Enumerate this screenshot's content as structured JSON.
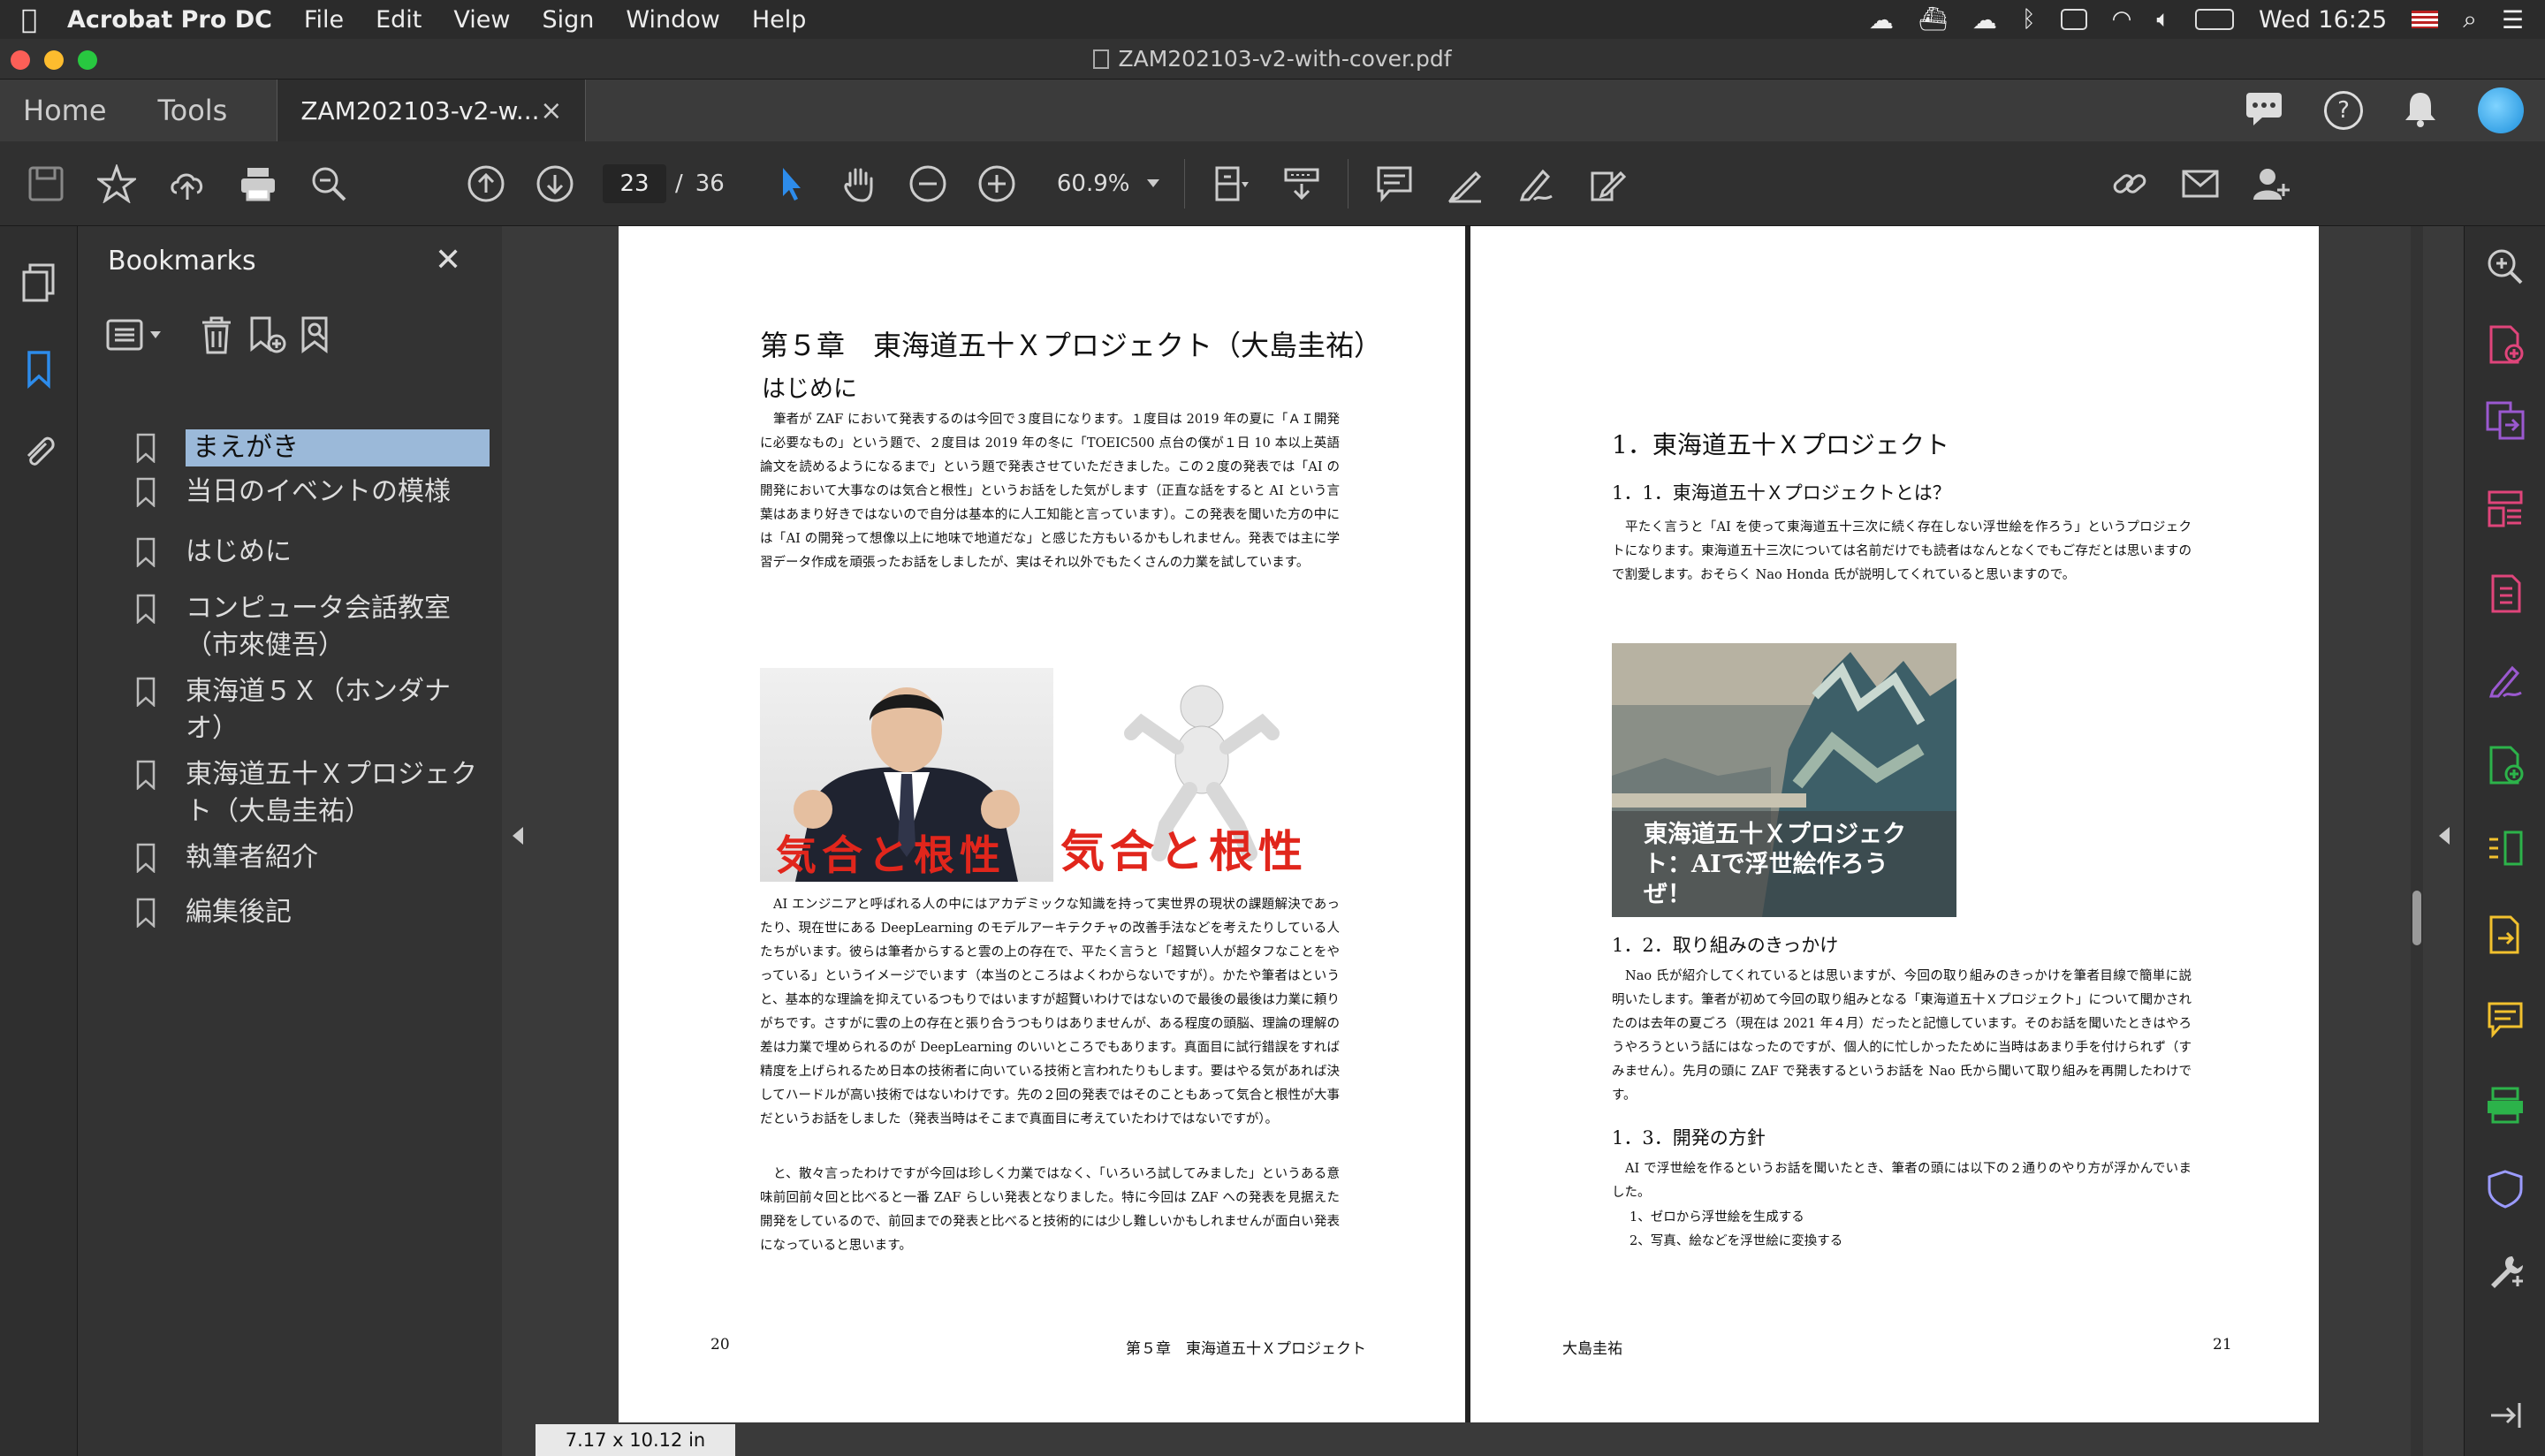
{
  "menubar": {
    "app_name": "Acrobat Pro DC",
    "items": [
      "File",
      "Edit",
      "View",
      "Sign",
      "Window",
      "Help"
    ],
    "clock": "Wed 16:25"
  },
  "window": {
    "title": "ZAM202103-v2-with-cover.pdf"
  },
  "tabs": {
    "home": "Home",
    "tools": "Tools",
    "document": "ZAM202103-v2-w...",
    "close": "×"
  },
  "toolbar": {
    "current_page": "23",
    "page_separator": "/",
    "total_pages": "36",
    "zoom": "60.9%"
  },
  "bookmarks": {
    "title": "Bookmarks",
    "close": "✕",
    "items": [
      {
        "label": "まえがき",
        "selected": true
      },
      {
        "label": "当日のイベントの模様"
      },
      {
        "label": "はじめに"
      },
      {
        "label": "コンピュータ会話教室（市來健吾）"
      },
      {
        "label": "東海道５Ｘ（ホンダナオ）"
      },
      {
        "label": "東海道五十Ｘプロジェクト（大島圭祐）"
      },
      {
        "label": "執筆者紹介"
      },
      {
        "label": "編集後記"
      }
    ]
  },
  "page_left": {
    "chapter_title": "第５章　東海道五十Ｘプロジェクト（大島圭祐）",
    "section": "はじめに",
    "para1": "筆者が ZAF において発表するのは今回で３度目になります。１度目は 2019 年の夏に「ＡＩ開発に必要なもの」という題で、２度目は 2019 年の冬に「TOEIC500 点台の僕が１日 10 本以上英語論文を読めるようになるまで」という題で発表させていただきました。この２度の発表では「AI の開発において大事なのは気合と根性」というお話をした気がします（正直な話をすると AI という言葉はあまり好きではないので自分は基本的に人工知能と言っています）。この発表を聞いた方の中には「AI の開発って想像以上に地味で地道だな」と感じた方もいるかもしれません。発表では主に学習データ作成を頑張ったお話をしましたが、実はそれ以外でもたくさんの力業を試しています。",
    "kiai1": "気合と根性",
    "kiai2": "気合と根性",
    "para2": "AI エンジニアと呼ばれる人の中にはアカデミックな知識を持って実世界の現状の課題解決であったり、現在世にある DeepLearning のモデルアーキテクチャの改善手法などを考えたりしている人たちがいます。彼らは筆者からすると雲の上の存在で、平たく言うと「超賢い人が超タフなことをやっている」というイメージでいます（本当のところはよくわからないですが）。かたや筆者はというと、基本的な理論を抑えているつもりではいますが超賢いわけではないので最後の最後は力業に頼りがちです。さすがに雲の上の存在と張り合うつもりはありませんが、ある程度の頭脳、理論の理解の差は力業で埋められるのが DeepLearning のいいところでもあります。真面目に試行錯誤をすれば精度を上げられるため日本の技術者に向いている技術と言われたりもします。要はやる気があれば決してハードルが高い技術ではないわけです。先の２回の発表ではそのこともあって気合と根性が大事だというお話をしました（発表当時はそこまで真面目に考えていたわけではないですが）。",
    "para3": "と、散々言ったわけですが今回は珍しく力業ではなく、「いろいろ試してみました」というある意味前回前々回と比べると一番 ZAF らしい発表となりました。特に今回は ZAF への発表を見据えた開発をしているので、前回までの発表と比べると技術的には少し難しいかもしれませんが面白い発表になっていると思います。",
    "page_number": "20",
    "running_head": "第５章　東海道五十Ｘプロジェクト"
  },
  "page_right": {
    "heading": "1．東海道五十Ｘプロジェクト",
    "sub1": "1．1．東海道五十Ｘプロジェクトとは？",
    "para1": "平たく言うと「AI を使って東海道五十三次に続く存在しない浮世絵を作ろう」というプロジェクトになります。東海道五十三次については名前だけでも読者はなんとなくでもご存だとは思いますので割愛します。おそらく Nao Honda 氏が説明してくれていると思いますので。",
    "image_caption": "東海道五十Ｘプロジェクト：AIで浮世絵作ろうぜ！",
    "sub2": "1．2．取り組みのきっかけ",
    "para2": "Nao 氏が紹介してくれているとは思いますが、今回の取り組みのきっかけを筆者目線で簡単に説明いたします。筆者が初めて今回の取り組みとなる「東海道五十Ｘプロジェクト」について聞かされたのは去年の夏ごろ（現在は 2021 年４月）だったと記憶しています。そのお話を聞いたときはやろうやろうという話にはなったのですが、個人的に忙しかったために当時はあまり手を付けられず（すみません）。先月の頭に ZAF で発表するというお話を Nao 氏から聞いて取り組みを再開したわけです。",
    "sub3": "1．3．開発の方針",
    "para3": "AI で浮世絵を作るというお話を聞いたとき、筆者の頭には以下の２通りのやり方が浮かんでいました。",
    "list1": "1、ゼロから浮世絵を生成する",
    "list2": "2、写真、絵などを浮世絵に変換する",
    "running_head": "大島圭祐",
    "page_number": "21"
  },
  "status": {
    "page_size": "7.17 x 10.12 in"
  },
  "colors": {
    "accent_blue": "#2d8ceb",
    "kiai_red": "#e1261c",
    "bookmark_selected": "#9bb9d9",
    "tool_pink": "#e0457b",
    "tool_purple": "#9b59d0",
    "tool_yellow": "#f2c12e",
    "tool_green": "#2cb34a"
  }
}
